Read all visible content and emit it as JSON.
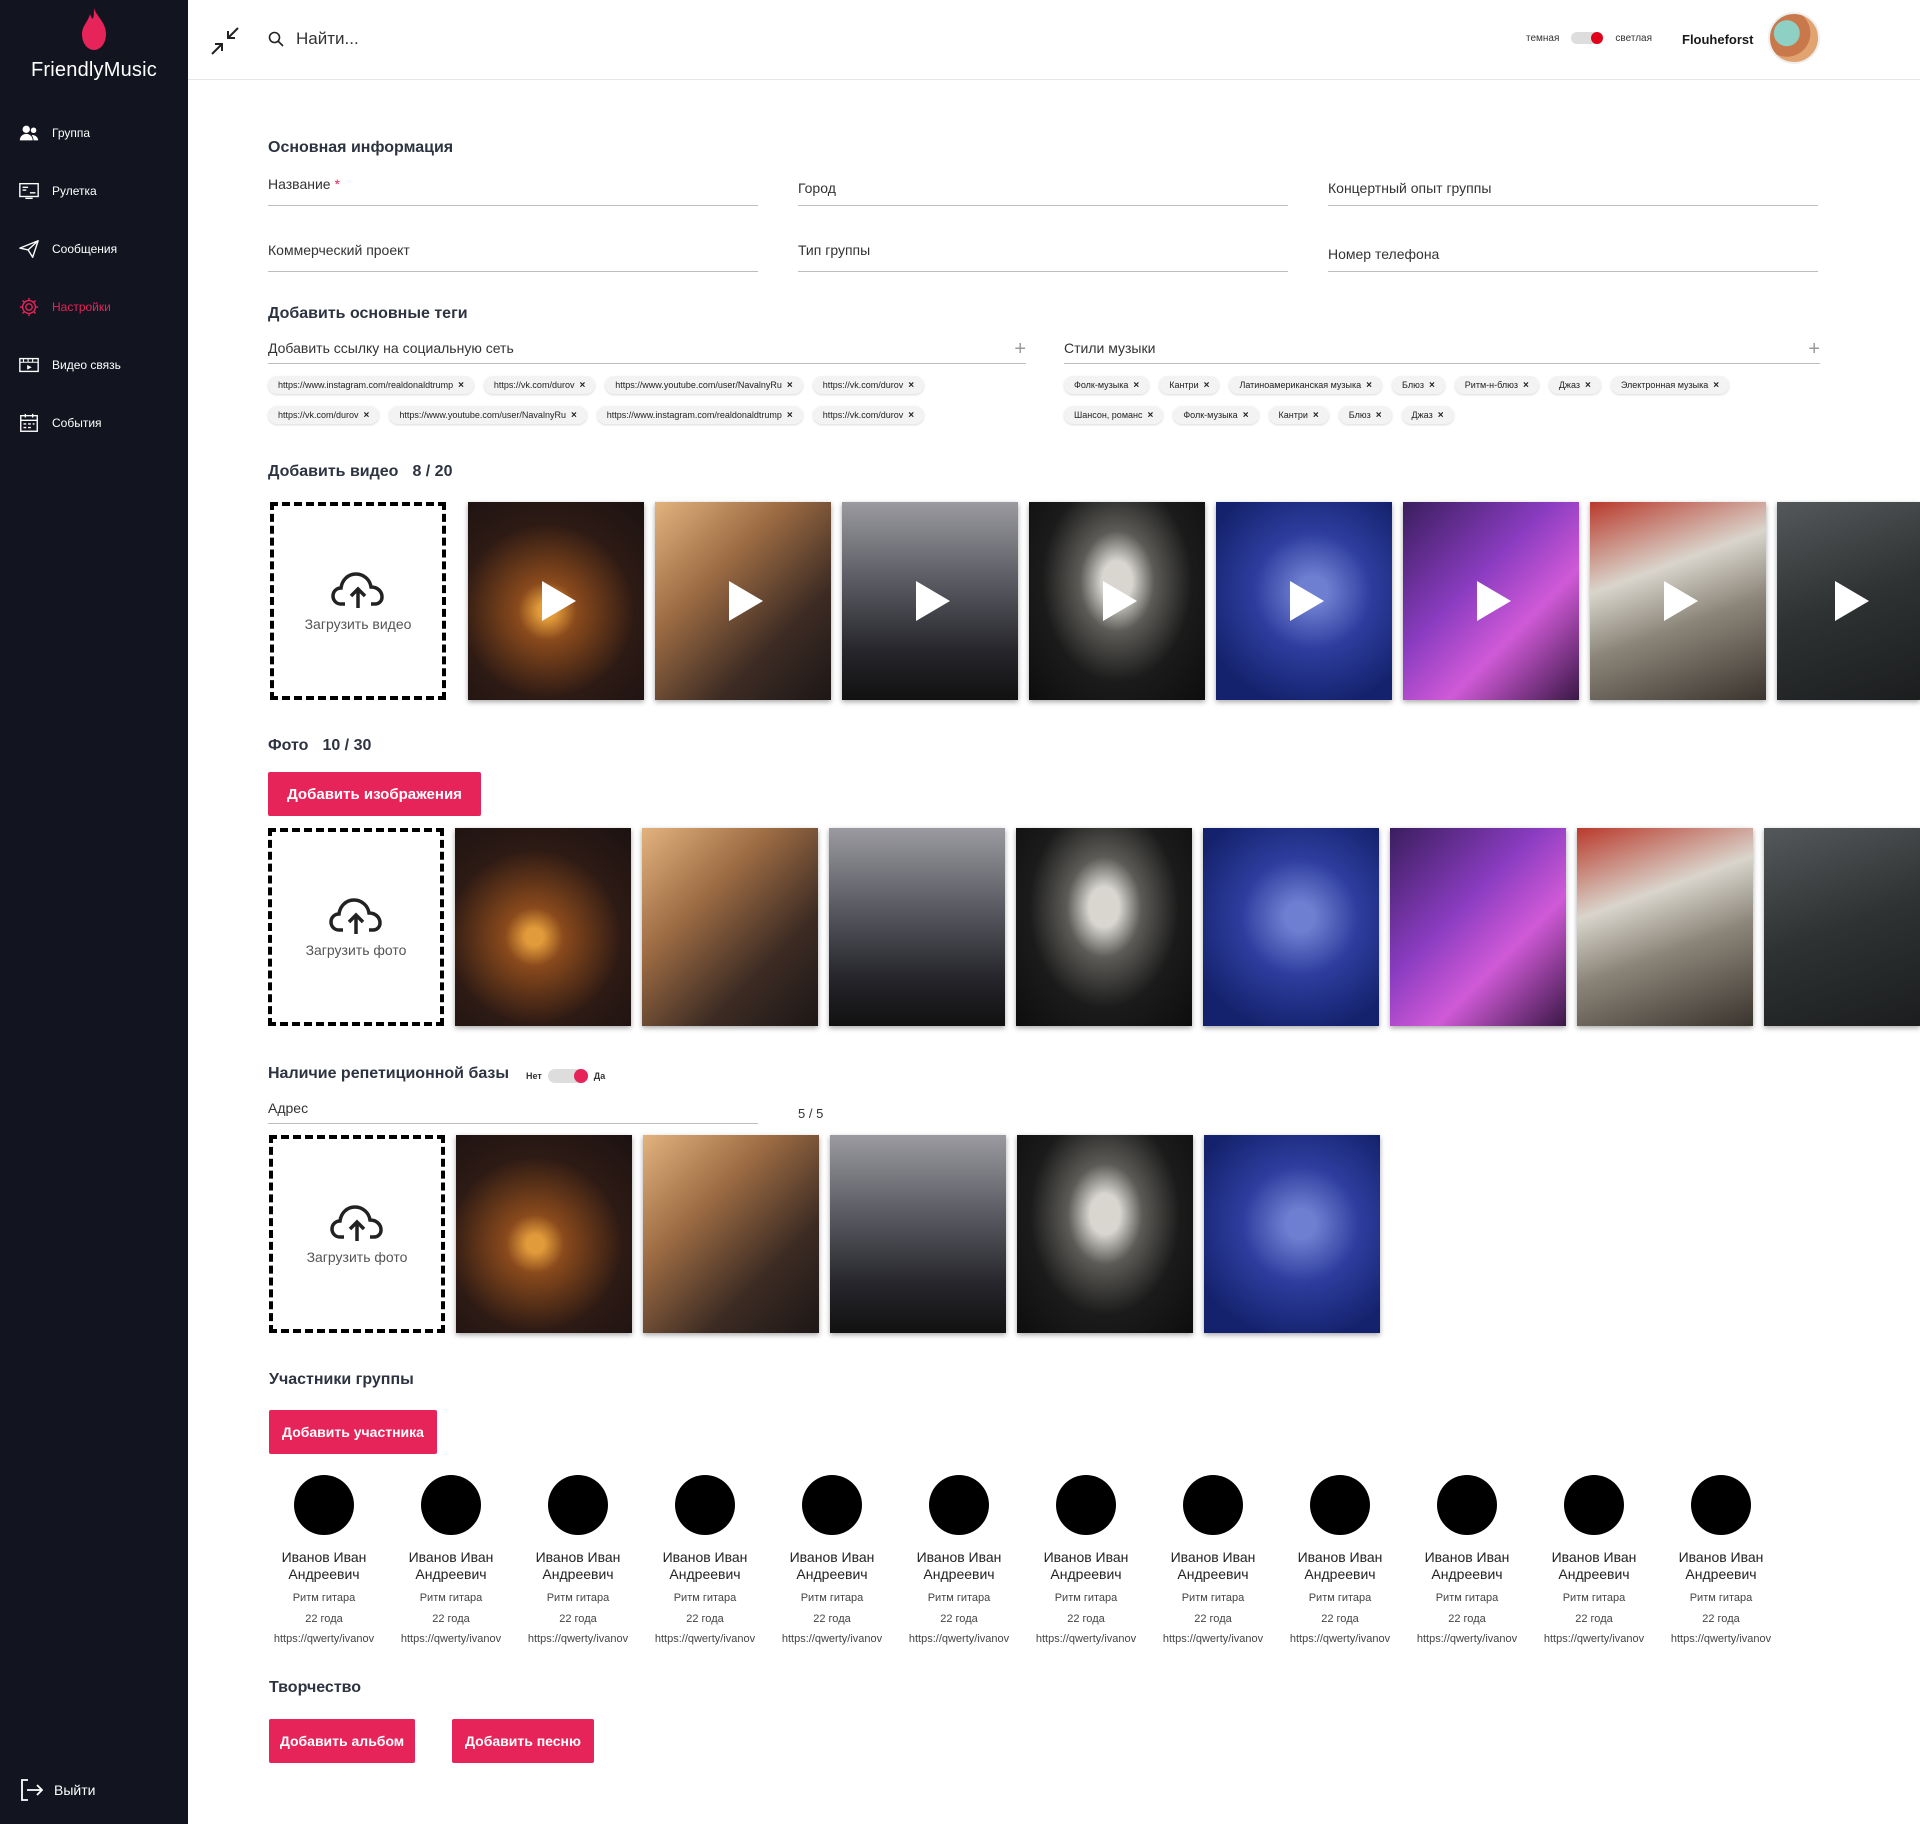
{
  "sidebar": {
    "brand": "FriendlyMusic",
    "items": [
      {
        "label": "Группа",
        "icon": "users-icon"
      },
      {
        "label": "Рулетка",
        "icon": "roulette-icon"
      },
      {
        "label": "Сообщения",
        "icon": "send-icon"
      },
      {
        "label": "Настройки",
        "icon": "gear-icon",
        "active": true
      },
      {
        "label": "Видео связь",
        "icon": "video-icon"
      },
      {
        "label": "События",
        "icon": "calendar-icon"
      }
    ],
    "logout": "Выйти"
  },
  "header": {
    "search_placeholder": "Найти...",
    "theme_dark": "темная",
    "theme_light": "светлая",
    "username": "Flouheforst"
  },
  "basic_info": {
    "title": "Основная информация",
    "name_label": "Название",
    "name_required": "*",
    "city_label": "Город",
    "concert_label": "Концертный опыт группы",
    "commercial_label": "Коммерческий проект",
    "type_label": "Тип группы",
    "phone_label": "Номер телефона"
  },
  "tags": {
    "title": "Добавить основные теги",
    "social_label": "Добавить ссылку на социальную сеть",
    "styles_label": "Стили музыки",
    "social_links": [
      "https://www.instagram.com/realdonaldtrump",
      "https://vk.com/durov",
      "https://www.youtube.com/user/NavalnyRu",
      "https://vk.com/durov",
      "https://vk.com/durov",
      "https://www.youtube.com/user/NavalnyRu",
      "https://www.instagram.com/realdonaldtrump",
      "https://vk.com/durov"
    ],
    "styles": [
      "Фолк-музыка",
      "Кантри",
      "Латиноамериканская музыка",
      "Блюз",
      "Ритм-н-блюз",
      "Джаз",
      "Электронная музыка",
      "Шансон, романс",
      "Фолк-музыка",
      "Кантри",
      "Блюз",
      "Джаз"
    ]
  },
  "videos": {
    "title": "Добавить видео",
    "count": "8 / 20",
    "upload_label": "Загрузить видео"
  },
  "photos": {
    "title": "Фото",
    "count": "10 / 30",
    "add_button": "Добавить изображения",
    "upload_label": "Загрузить фото"
  },
  "rehearsal": {
    "title": "Наличие репетиционной базы",
    "no": "Нет",
    "yes": "Да",
    "address_label": "Адрес",
    "count": "5 / 5",
    "upload_label": "Загрузить фото"
  },
  "members": {
    "title": "Участники группы",
    "add_button": "Добавить участника",
    "list": [
      {
        "name": "Иванов Иван Андреевич",
        "role": "Ритм гитара",
        "age": "22 года",
        "link": "https://qwerty/ivanov"
      },
      {
        "name": "Иванов Иван Андреевич",
        "role": "Ритм гитара",
        "age": "22 года",
        "link": "https://qwerty/ivanov"
      },
      {
        "name": "Иванов Иван Андреевич",
        "role": "Ритм гитара",
        "age": "22 года",
        "link": "https://qwerty/ivanov"
      },
      {
        "name": "Иванов Иван Андреевич",
        "role": "Ритм гитара",
        "age": "22 года",
        "link": "https://qwerty/ivanov"
      },
      {
        "name": "Иванов Иван Андреевич",
        "role": "Ритм гитара",
        "age": "22 года",
        "link": "https://qwerty/ivanov"
      },
      {
        "name": "Иванов Иван Андреевич",
        "role": "Ритм гитара",
        "age": "22 года",
        "link": "https://qwerty/ivanov"
      },
      {
        "name": "Иванов Иван Андреевич",
        "role": "Ритм гитара",
        "age": "22 года",
        "link": "https://qwerty/ivanov"
      },
      {
        "name": "Иванов Иван Андреевич",
        "role": "Ритм гитара",
        "age": "22 года",
        "link": "https://qwerty/ivanov"
      },
      {
        "name": "Иванов Иван Андреевич",
        "role": "Ритм гитара",
        "age": "22 года",
        "link": "https://qwerty/ivanov"
      },
      {
        "name": "Иванов Иван Андреевич",
        "role": "Ритм гитара",
        "age": "22 года",
        "link": "https://qwerty/ivanov"
      },
      {
        "name": "Иванов Иван Андреевич",
        "role": "Ритм гитара",
        "age": "22 года",
        "link": "https://qwerty/ivanov"
      },
      {
        "name": "Иванов Иван Андреевич",
        "role": "Ритм гитара",
        "age": "22 года",
        "link": "https://qwerty/ivanov"
      }
    ]
  },
  "creative": {
    "title": "Творчество",
    "add_album": "Добавить альбом",
    "add_song": "Добавить песню"
  },
  "colors": {
    "accent": "#e6245a",
    "sidebar_bg": "#12141f"
  }
}
